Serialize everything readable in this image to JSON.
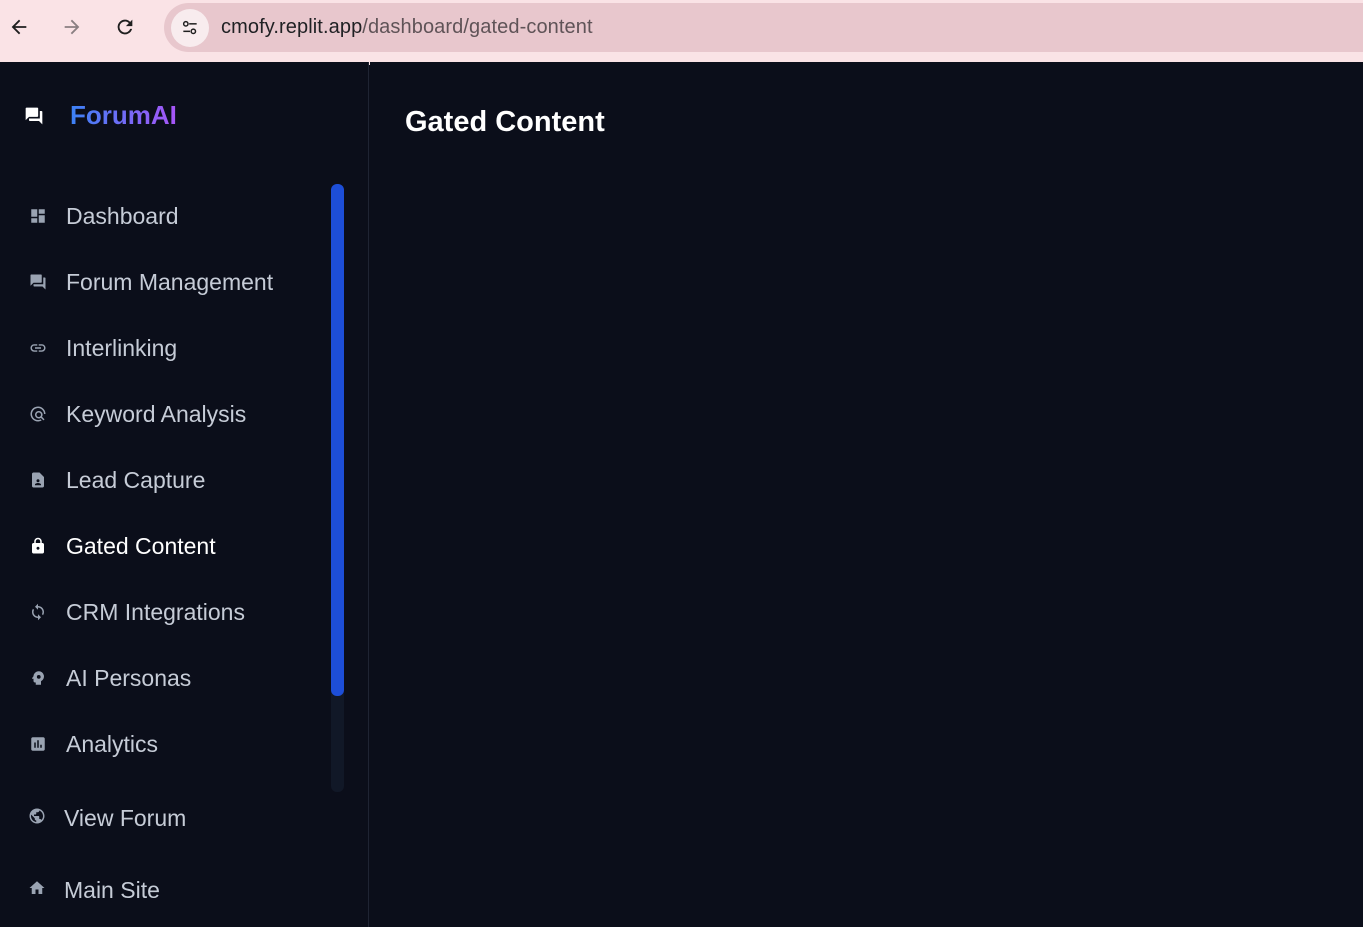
{
  "browser": {
    "url_host": "cmofy.replit.app",
    "url_path": "/dashboard/gated-content"
  },
  "brand": {
    "name": "ForumAI",
    "icon": "forum-icon",
    "gradient_start": "#3b82f6",
    "gradient_end": "#a855f7"
  },
  "sidebar": {
    "items": [
      {
        "label": "Dashboard",
        "icon": "dashboard-icon",
        "active": false
      },
      {
        "label": "Forum Management",
        "icon": "forum-icon",
        "active": false
      },
      {
        "label": "Interlinking",
        "icon": "link-icon",
        "active": false
      },
      {
        "label": "Keyword Analysis",
        "icon": "keyword-search-icon",
        "active": false
      },
      {
        "label": "Lead Capture",
        "icon": "document-icon",
        "active": false
      },
      {
        "label": "Gated Content",
        "icon": "lock-icon",
        "active": true
      },
      {
        "label": "CRM Integrations",
        "icon": "sync-icon",
        "active": false
      },
      {
        "label": "AI Personas",
        "icon": "psychology-icon",
        "active": false
      },
      {
        "label": "Analytics",
        "icon": "analytics-icon",
        "active": false
      }
    ],
    "bottom": {
      "view_forum": "View Forum",
      "main_site": "Main Site"
    },
    "scroll_accent": "#1d4ed8"
  },
  "main": {
    "title": "Gated Content"
  },
  "colors": {
    "background": "#0b0e1a",
    "browser_bar": "#fae3e6"
  }
}
